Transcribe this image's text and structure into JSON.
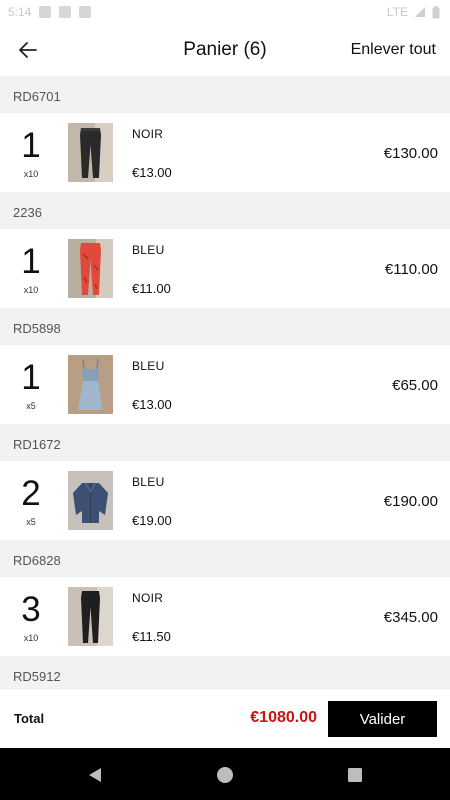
{
  "status_bar": {
    "time": "5:14",
    "network": "LTE"
  },
  "header": {
    "title": "Panier (6)",
    "clear_all_label": "Enlever tout"
  },
  "cart": {
    "groups": [
      {
        "ref": "RD6701",
        "quantity": "1",
        "pack": "x10",
        "color": "NOIR",
        "unit_price": "€13.00",
        "line_total": "€130.00",
        "product_image": "black-jogger-pants"
      },
      {
        "ref": "2236",
        "quantity": "1",
        "pack": "x10",
        "color": "BLEU",
        "unit_price": "€11.00",
        "line_total": "€110.00",
        "product_image": "red-pants"
      },
      {
        "ref": "RD5898",
        "quantity": "1",
        "pack": "x5",
        "color": "BLEU",
        "unit_price": "€13.00",
        "line_total": "€65.00",
        "product_image": "denim-dress"
      },
      {
        "ref": "RD1672",
        "quantity": "2",
        "pack": "x5",
        "color": "BLEU",
        "unit_price": "€19.00",
        "line_total": "€190.00",
        "product_image": "denim-jacket"
      },
      {
        "ref": "RD6828",
        "quantity": "3",
        "pack": "x10",
        "color": "NOIR",
        "unit_price": "€11.50",
        "line_total": "€345.00",
        "product_image": "black-pants"
      },
      {
        "ref": "RD5912",
        "quantity": "",
        "pack": "",
        "color": "",
        "unit_price": "",
        "line_total": "",
        "product_image": "partially-visible-product"
      }
    ]
  },
  "footer": {
    "total_label": "Total",
    "total_value": "€1080.00",
    "validate_label": "Valider"
  },
  "colors": {
    "accent_price": "#cc1313",
    "button_bg": "#000000",
    "group_bg": "#f2f2f2"
  },
  "icons": {
    "back": "arrow-left-icon",
    "nav_back": "triangle-back-icon",
    "nav_home": "circle-home-icon",
    "nav_recents": "square-recents-icon"
  }
}
